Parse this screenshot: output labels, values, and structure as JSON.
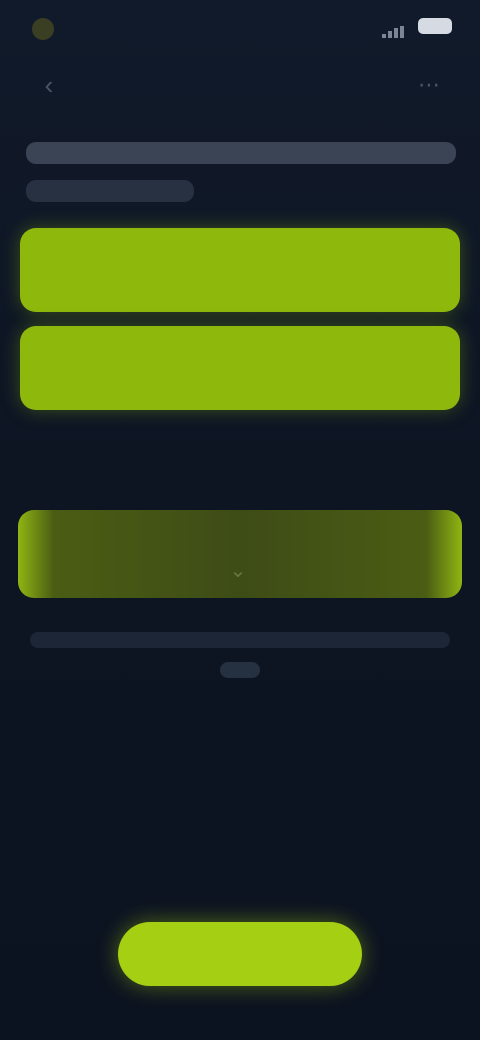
{
  "status_bar": {
    "time": "",
    "icons": [
      "app-dot-icon",
      "signal-icon",
      "battery-icon"
    ]
  },
  "header": {
    "title": "",
    "back_icon": "chevron-left-icon",
    "action_icon": "dots-icon"
  },
  "intro": {
    "text": ""
  },
  "options": [
    {
      "label": ""
    },
    {
      "label": ""
    }
  ],
  "sub_label": "",
  "toggle": {
    "label": "",
    "icon": "chevron-down-icon"
  },
  "note": {
    "text": ""
  },
  "cta": {
    "label": ""
  },
  "colors": {
    "background": "#0d1422",
    "accent": "#8eb80c",
    "cta": "#a4cf12"
  }
}
